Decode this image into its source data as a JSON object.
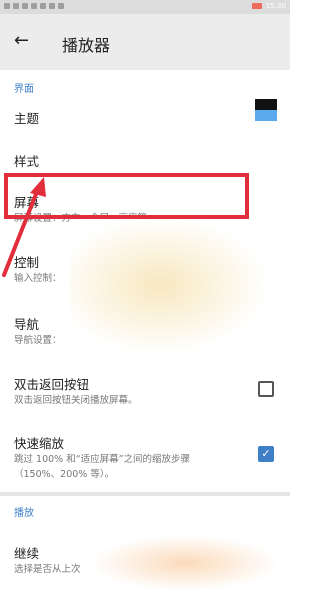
{
  "status_bar": {
    "time": "15:30",
    "icons": [
      "sim-icon",
      "signal-icon",
      "wifi-icon",
      "app-icon",
      "app-icon",
      "app-icon",
      "app-icon"
    ],
    "battery_color": "#f06b5a"
  },
  "toolbar": {
    "back_icon": "arrow-back-icon",
    "title": "播放器"
  },
  "sections": {
    "interface": "界面",
    "playback": "播放"
  },
  "settings": {
    "theme": {
      "title": "主题",
      "swatch_colors": [
        "#111111",
        "#5aaaf0"
      ]
    },
    "style": {
      "title": "样式"
    },
    "screen": {
      "title": "屏幕",
      "subtitle": "屏幕设置：方向、全屏、亮度等。"
    },
    "control": {
      "title": "控制",
      "subtitle": "输入控制："
    },
    "navigation": {
      "title": "导航",
      "subtitle": "导航设置："
    },
    "double_back": {
      "title": "双击返回按钮",
      "subtitle": "双击返回按钮关闭播放屏幕。",
      "checked": false
    },
    "quick_zoom": {
      "title": "快速缩放",
      "subtitle_line1": "跳过 100% 和“适应屏幕”之间的缩放步骤",
      "subtitle_line2": "（150%、200% 等）。",
      "checked": true
    },
    "resume": {
      "title": "继续",
      "subtitle": "选择是否从上次"
    }
  },
  "colors": {
    "accent": "#3f7fc8",
    "annotation": "#e22d3a"
  }
}
